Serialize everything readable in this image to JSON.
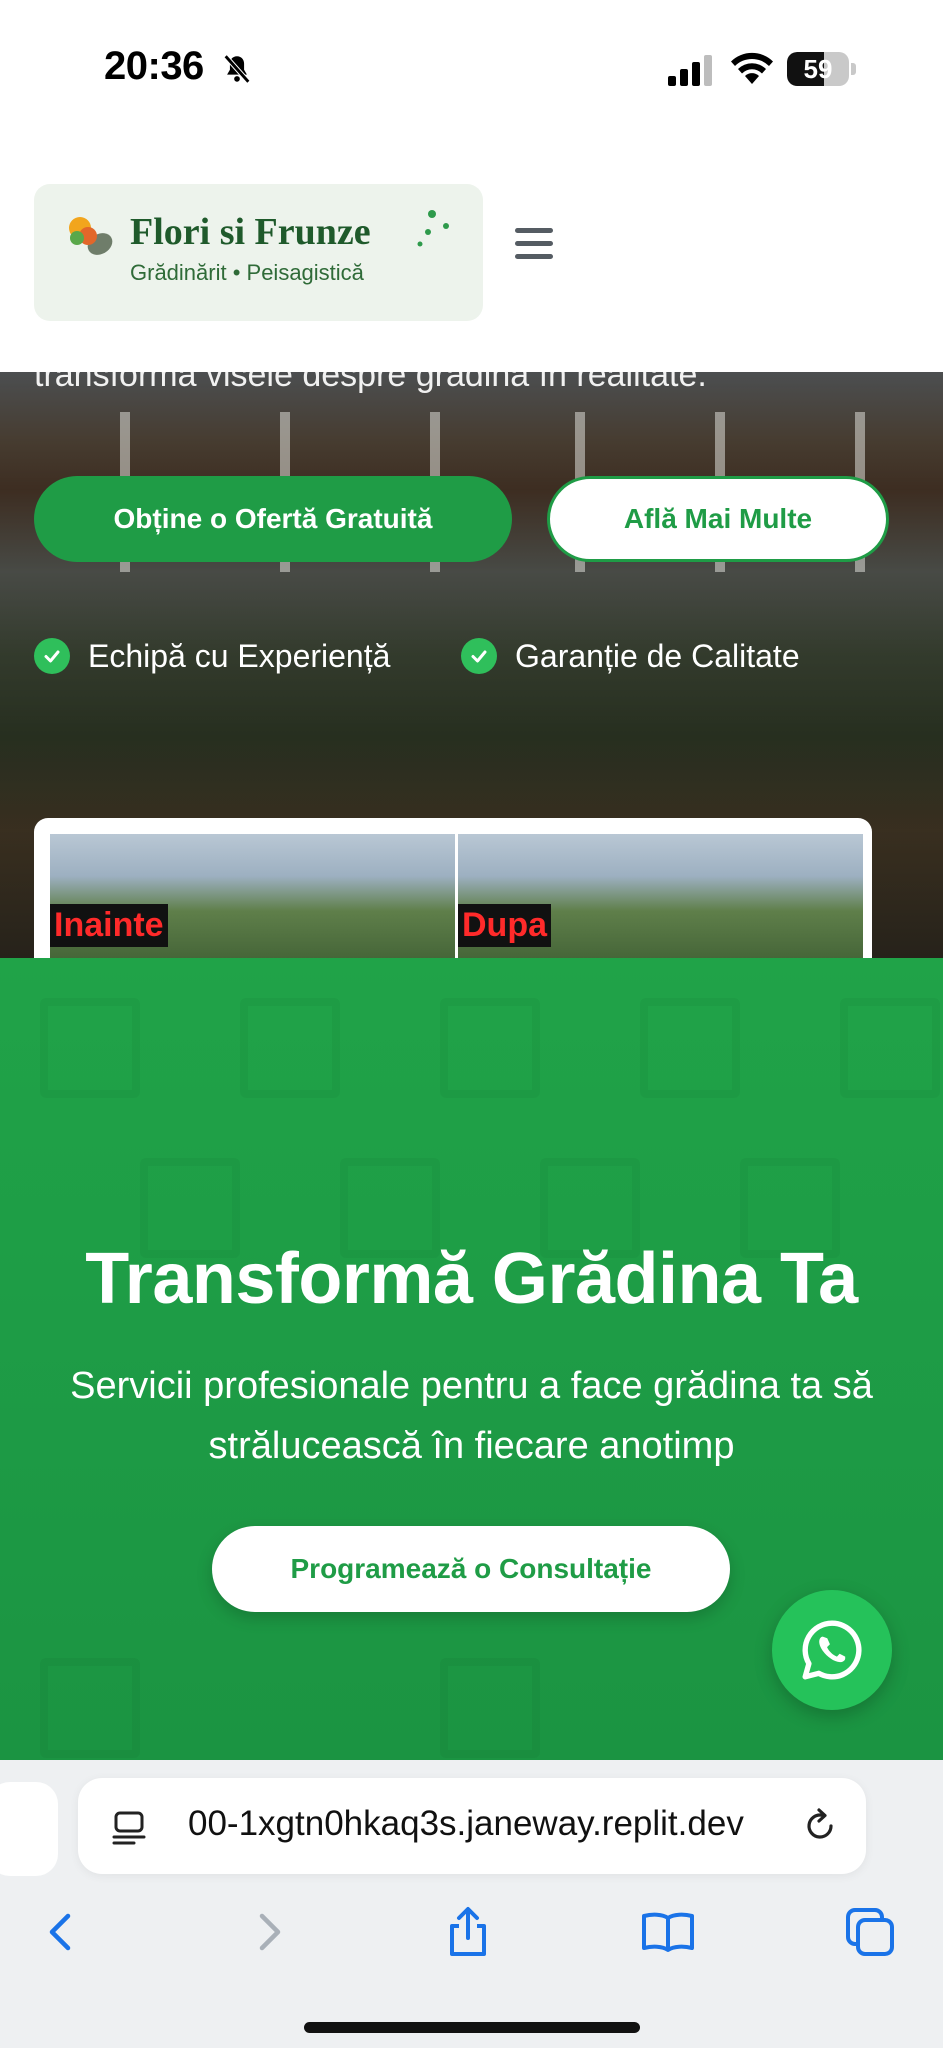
{
  "status_bar": {
    "time": "20:36",
    "battery_level": "59",
    "battery_fraction": 0.59
  },
  "header": {
    "brand_title": "Flori si Frunze",
    "brand_subtitle": "Grădinărit • Peisagistică",
    "menu_icon": "hamburger-icon"
  },
  "hero": {
    "tagline_fragment": "transformă visele despre grădină în realitate.",
    "primary_button": "Obține o Ofertă Gratuită",
    "secondary_button": "Află Mai Multe",
    "features": [
      "Echipă cu Experiență",
      "Garanție de Calitate"
    ],
    "compare": {
      "before_label": "Inainte",
      "after_label": "Dupa"
    }
  },
  "cta": {
    "title": "Transformă Grădina Ta",
    "subtitle": "Servicii profesionale pentru a face grădina ta să strălucească în fiecare anotimp",
    "button": "Programează o Consultație"
  },
  "browser": {
    "url": "00-1xgtn0hkaq3s.janeway.replit.dev"
  },
  "colors": {
    "brand_green": "#1f9c46",
    "check_green": "#2fbf5b",
    "whatsapp_green": "#25c25a",
    "logo_text": "#1f5a2b"
  }
}
